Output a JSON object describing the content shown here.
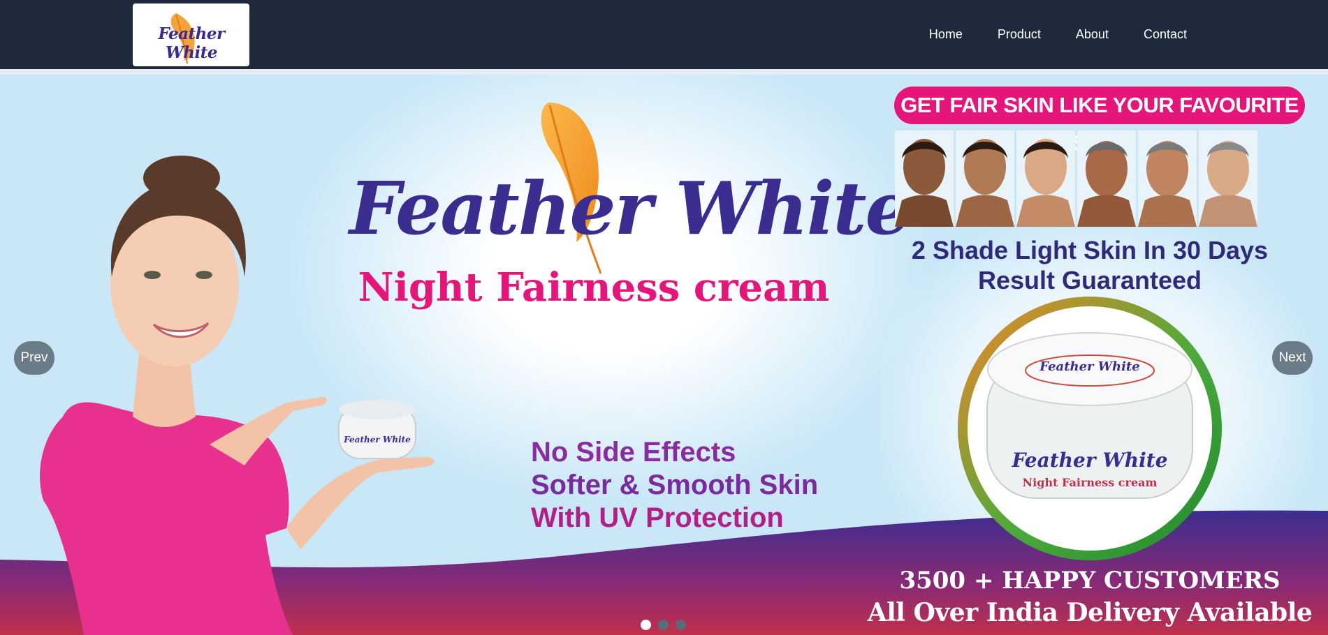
{
  "header": {
    "logo_text": "Feather White",
    "nav": [
      {
        "label": "Home"
      },
      {
        "label": "Product"
      },
      {
        "label": "About"
      },
      {
        "label": "Contact"
      }
    ]
  },
  "hero": {
    "brand": "Feather White",
    "subtitle": "Night Fairness cream",
    "features": [
      "No Side Effects",
      "Softer & Smooth Skin",
      "With UV Protection"
    ],
    "banner": "GET FAIR SKIN LIKE YOUR FAVOURITE STAR",
    "claim_line1": "2 Shade Light Skin In 30 Days",
    "claim_line2": "Result Guaranteed",
    "jar_brand": "Feather White",
    "jar_sub": "Night Fairness cream",
    "customers": "3500 + HAPPY CUSTOMERS",
    "delivery": "All Over India Delivery Available"
  },
  "carousel": {
    "prev_label": "Prev",
    "next_label": "Next",
    "slide_count": 3,
    "active_slide": 1
  },
  "colors": {
    "navbar": "#1e293b",
    "brand_purple": "#3b2c8f",
    "accent_pink": "#e5157a",
    "sky": "#c6e5f6",
    "control_gray": "#6b7b88"
  }
}
